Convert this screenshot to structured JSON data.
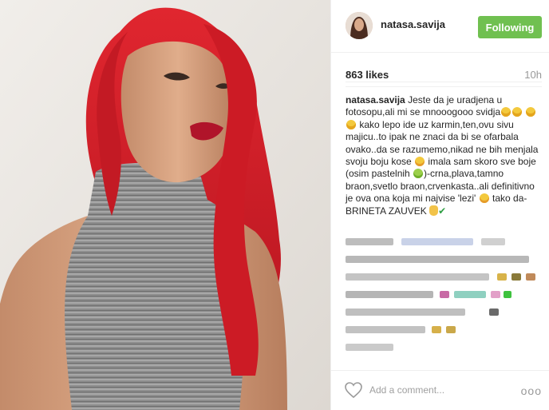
{
  "post": {
    "username": "natasa.savija",
    "follow_label": "Following",
    "likes": "863 likes",
    "time_ago": "10h",
    "caption": {
      "user": "natasa.savija",
      "t1": "Jeste da je uradjena u fotosopu,ali mi se mnooogooo svidja",
      "t2": "kako lepo ide uz karmin,ten,ovu sivu majicu..to ipak ne znaci da bi se ofarbala ovako..da se razumemo,nikad ne bih menjala svoju boju kose",
      "t3": "imala sam skoro sve boje (osim pastelnih",
      "t4": ")-crna,plava,tamno braon,svetlo braon,crvenkasta..ali definitivno je ova ona koja mi najvise 'lezi'",
      "t5": "tako da-BRINETA ZAUVEK"
    },
    "comment_placeholder": "Add a comment...",
    "more_label": "ooo"
  },
  "icons": {
    "heart": "heart-outline-icon",
    "more": "more-options-icon"
  },
  "colors": {
    "follow_button": "#70c050",
    "hair": "#d5202a",
    "lips": "#b0142a",
    "top": "#9a9a9a",
    "background": "#e9e5e1"
  }
}
